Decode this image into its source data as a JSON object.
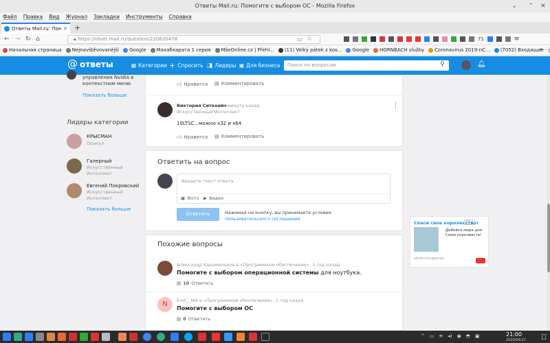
{
  "window": {
    "title": "Ответы Mail.ru: Помогите с выбором ОС - Mozilla Firefox"
  },
  "menu": [
    "Файл",
    "Правка",
    "Вид",
    "Журнал",
    "Закладки",
    "Инструменты",
    "Справка"
  ],
  "tab": {
    "title": "Ответы Mail.ru: Помогите"
  },
  "url": "https://otvet.mail.ru/question/220620478",
  "toolbar_badge": "71",
  "bookmarks": [
    "Начальная страница",
    "Nejnavštěvovanější",
    "Google",
    "Махабхарата 1 серия",
    "MšeOnline.cz | Přehl...",
    "(11) Velký pátek z kos...",
    "Google",
    "HORNBACH služby",
    "Coronavirus 2019-nC...",
    "(7052) Входящие - jir..."
  ],
  "site": {
    "logo": "ответы",
    "nav": [
      "Категории",
      "Спросить",
      "Лидеры",
      "Для бизнеса"
    ],
    "search_placeholder": "Поиск по вопросам"
  },
  "sidebar": {
    "top_text": "управления Nvidia в контекстном меню",
    "show_more1": "Показать больше",
    "leaders_title": "Лидеры категории",
    "leaders": [
      {
        "name": "КРЫСМАН",
        "rank": "Оракул"
      },
      {
        "name": "Галерный",
        "rank": "Искусственный Интеллект"
      },
      {
        "name": "Евгений Покровский",
        "rank": "Искусственный Интеллект"
      }
    ],
    "show_more2": "Показать больше"
  },
  "answers": {
    "like": "Нравится",
    "comment": "Комментировать",
    "answer": {
      "author": "Виктория Ситкевич",
      "time": "21 минуту назад",
      "rank": "Искусственный Интеллект",
      "text": "10LTSC...можно x32 и x64"
    }
  },
  "reply": {
    "title": "Ответить на вопрос",
    "placeholder": "Введите текст ответа",
    "photo": "Фото",
    "video": "Видео",
    "submit": "Ответить",
    "terms": "Нажимая на кнопку, вы принимаете условия",
    "terms_link": "пользовательского соглашения"
  },
  "similar": {
    "title": "Похожие вопросы",
    "items": [
      {
        "meta": "Александр Карамельков в «Программное обеспечение», 1 год назад",
        "title_bold": "Помогите с выбором операционной системы",
        "title_rest": " для ноутбука.",
        "count": "10",
        "answer": "Ответить"
      },
      {
        "meta": "Emil__Nik в «Программное обеспечение», 1 год назад",
        "title_bold": "Помогите с выбором ОС",
        "title_rest": "",
        "count": "8",
        "answer": "Ответить",
        "avatar": "N"
      }
    ]
  },
  "ad": {
    "title": "Спаси свое королевство!",
    "age": "16+",
    "text": "Добейся мира для Семи королевств!",
    "domain": "store.my.games"
  },
  "clock": {
    "time": "21:00",
    "date": "2020/04/17"
  }
}
